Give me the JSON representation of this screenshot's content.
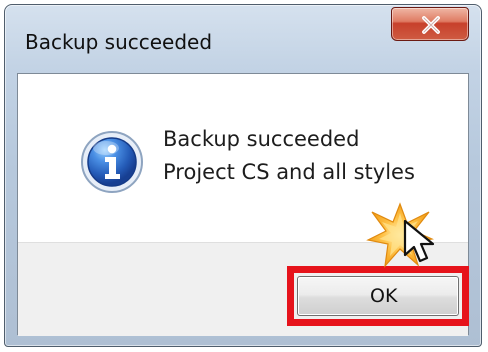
{
  "window": {
    "title": "Backup succeeded"
  },
  "message": {
    "line_1": "Backup succeeded",
    "line_2": "Project CS and all styles"
  },
  "buttons": {
    "ok_label": "OK"
  },
  "icons": {
    "titlebar_close": "close-icon",
    "message_icon": "info-icon",
    "click_indicator": "click-burst-icon",
    "pointer": "cursor-icon"
  },
  "colors": {
    "highlight": "#e6131b",
    "close_button": "#c7402b",
    "info_blue": "#2f67c8"
  }
}
